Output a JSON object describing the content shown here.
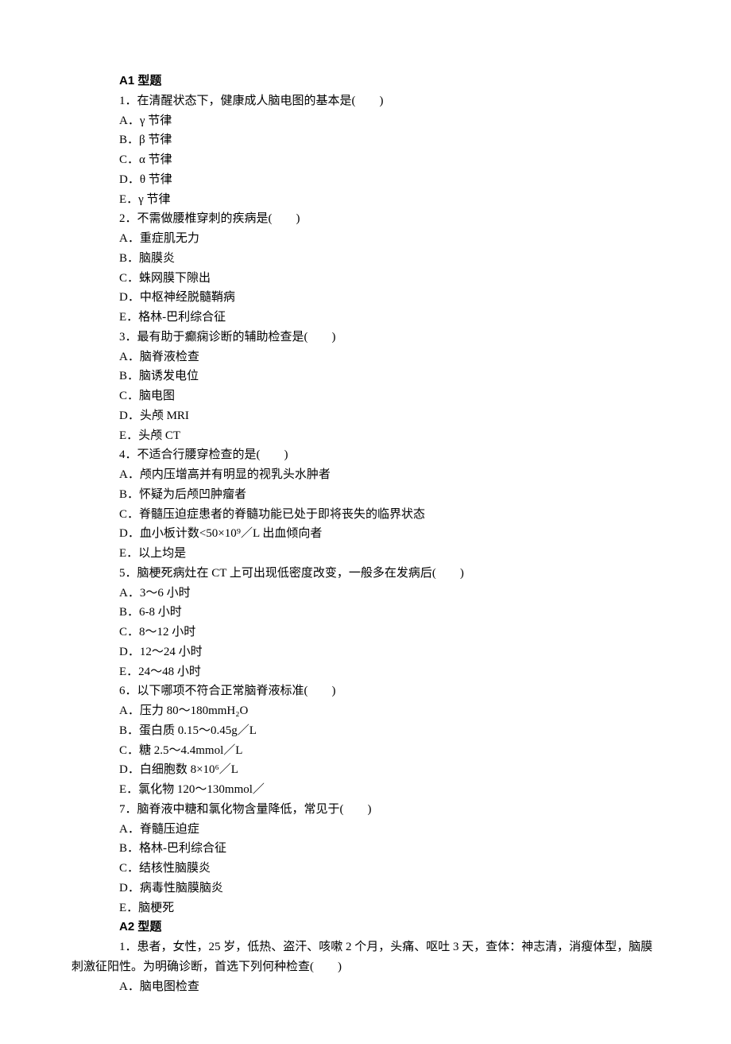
{
  "sections": {
    "a1_header": "A1 型题",
    "a2_header": "A2 型题"
  },
  "a1": [
    {
      "q": "1．在清醒状态下，健康成人脑电图的基本是(　　)",
      "opts": [
        "A．γ 节律",
        "B．β 节律",
        "C．α 节律",
        "D．θ 节律",
        "E．γ 节律"
      ]
    },
    {
      "q": "2．不需做腰椎穿刺的疾病是(　　)",
      "opts": [
        "A．重症肌无力",
        "B．脑膜炎",
        "C．蛛网膜下隙出",
        "D．中枢神经脱髓鞘病",
        "E．格林-巴利综合征"
      ]
    },
    {
      "q": "3．最有助于癫痫诊断的辅助检查是(　　)",
      "opts": [
        "A．脑脊液检查",
        "B．脑诱发电位",
        "C．脑电图",
        "D．头颅 MRI",
        "E．头颅 CT"
      ]
    },
    {
      "q": "4．不适合行腰穿检查的是(　　)",
      "opts": [
        "A．颅内压增高并有明显的视乳头水肿者",
        "B．怀疑为后颅凹肿瘤者",
        "C．脊髓压迫症患者的脊髓功能已处于即将丧失的临界状态",
        "D．血小板计数<50×10⁹／L 出血倾向者",
        "E．以上均是"
      ]
    },
    {
      "q": "5．脑梗死病灶在 CT 上可出现低密度改变，一般多在发病后(　　)",
      "opts": [
        "A．3～6 小时",
        "B．6-8 小时",
        "C．8～12 小时",
        "D．12～24 小时",
        "E．24～48 小时"
      ]
    },
    {
      "q": "6．以下哪项不符合正常脑脊液标准(　　)",
      "opts": [
        "A．压力 80～180mmH₂O",
        "B．蛋白质 0.15～0.45g／L",
        "C．糖 2.5～4.4mmol／L",
        "D．白细胞数 8×10⁶／L",
        "E．氯化物 120～130mmol／"
      ]
    },
    {
      "q": "7．脑脊液中糖和氯化物含量降低，常见于(　　)",
      "opts": [
        "A．脊髓压迫症",
        "B．格林-巴利综合征",
        "C．结核性脑膜炎",
        "D．病毒性脑膜脑炎",
        "E．脑梗死"
      ]
    }
  ],
  "a2": {
    "q_para": "1．患者，女性，25 岁，低热、盗汗、咳嗽 2 个月，头痛、呕吐 3 天，查体：神志清，消瘦体型，脑膜刺激征阳性。为明确诊断，首选下列何种检查(　　)",
    "opts": [
      "A．脑电图检查"
    ]
  }
}
